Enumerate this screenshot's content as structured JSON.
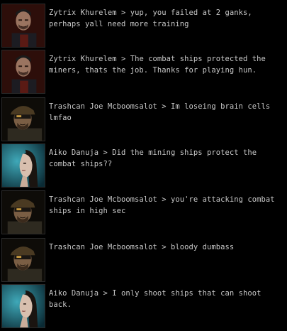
{
  "chat": {
    "messages": [
      {
        "speaker": "Zytrix Khurelem",
        "separator": ">",
        "text": "yup, you failed at 2 ganks, perhaps yall need more training",
        "portrait": "portrait-zytrix"
      },
      {
        "speaker": "Zytrix Khurelem",
        "separator": ">",
        "text": "The combat ships protected the miners, thats the job.  Thanks for playing hun.",
        "portrait": "portrait-zytrix"
      },
      {
        "speaker": "Trashcan Joe Mcboomsalot",
        "separator": ">",
        "text": "Im loseing brain cells lmfao",
        "portrait": "portrait-trashcan"
      },
      {
        "speaker": "Aiko Danuja",
        "separator": ">",
        "text": "Did the mining ships protect the combat ships??",
        "portrait": "portrait-aiko"
      },
      {
        "speaker": "Trashcan Joe Mcboomsalot",
        "separator": ">",
        "text": "you're attacking combat ships in high sec",
        "portrait": "portrait-trashcan"
      },
      {
        "speaker": "Trashcan Joe Mcboomsalot",
        "separator": ">",
        "text": "bloody dumbass",
        "portrait": "portrait-trashcan"
      },
      {
        "speaker": "Aiko Danuja",
        "separator": ">",
        "text": "I only shoot ships that can shoot back.",
        "portrait": "portrait-aiko"
      }
    ]
  },
  "colors": {
    "background": "#000000",
    "text": "#c8c8c8",
    "portrait_border": "#2a2a2a"
  }
}
